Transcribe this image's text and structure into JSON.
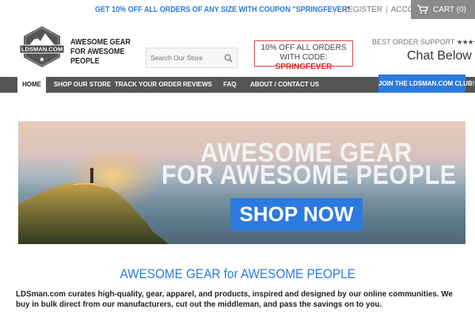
{
  "topbar": {
    "promo_text": "GET 10% OFF ALL ORDERS OF ANY SIZE WITH COUPON \"SPRINGFEVER\"",
    "register_label": "REGISTER",
    "account_label": "ACCOUNT",
    "cart_label": "CART (0)"
  },
  "header": {
    "logo_text": "LDSMAN.COM",
    "tagline": "AWESOME GEAR FOR AWESOME PEOPLE",
    "search_placeholder": "Search Our Store",
    "code_line1": "10% OFF ALL ORDERS",
    "code_line2_prefix": "WITH CODE: ",
    "code_value": "SPRINGFEVER",
    "support_label": "BEST ORDER SUPPORT",
    "support_stars": "★★★★★",
    "chat_label": "Chat Below"
  },
  "nav": {
    "items": [
      {
        "label": "HOME",
        "active": true
      },
      {
        "label": "SHOP OUR STORE"
      },
      {
        "label": "TRACK YOUR ORDER"
      },
      {
        "label": "REVIEWS"
      },
      {
        "label": "FAQ"
      },
      {
        "label": "ABOUT / CONTACT US"
      }
    ],
    "club_button": "JOIN THE LDSMAN.COM CLUB!"
  },
  "hero": {
    "title_line1": "AWESOME GEAR",
    "title_line2": "FOR AWESOME PEOPLE",
    "cta_label": "SHOP NOW"
  },
  "content": {
    "heading": "AWESOME GEAR for AWESOME PEOPLE",
    "intro": "LDSman.com curates high-quality, gear, apparel, and products, inspired and designed by our online communities. We buy in bulk direct from our manufacturers, cut out the middleman, and pass the savings on to you."
  },
  "colors": {
    "accent_blue": "#2c7ae0",
    "nav_gray": "#555555",
    "code_red": "#d42b2b"
  },
  "icons": {
    "search": "search-icon",
    "cart": "cart-icon",
    "logo": "mountain-badge-logo"
  }
}
